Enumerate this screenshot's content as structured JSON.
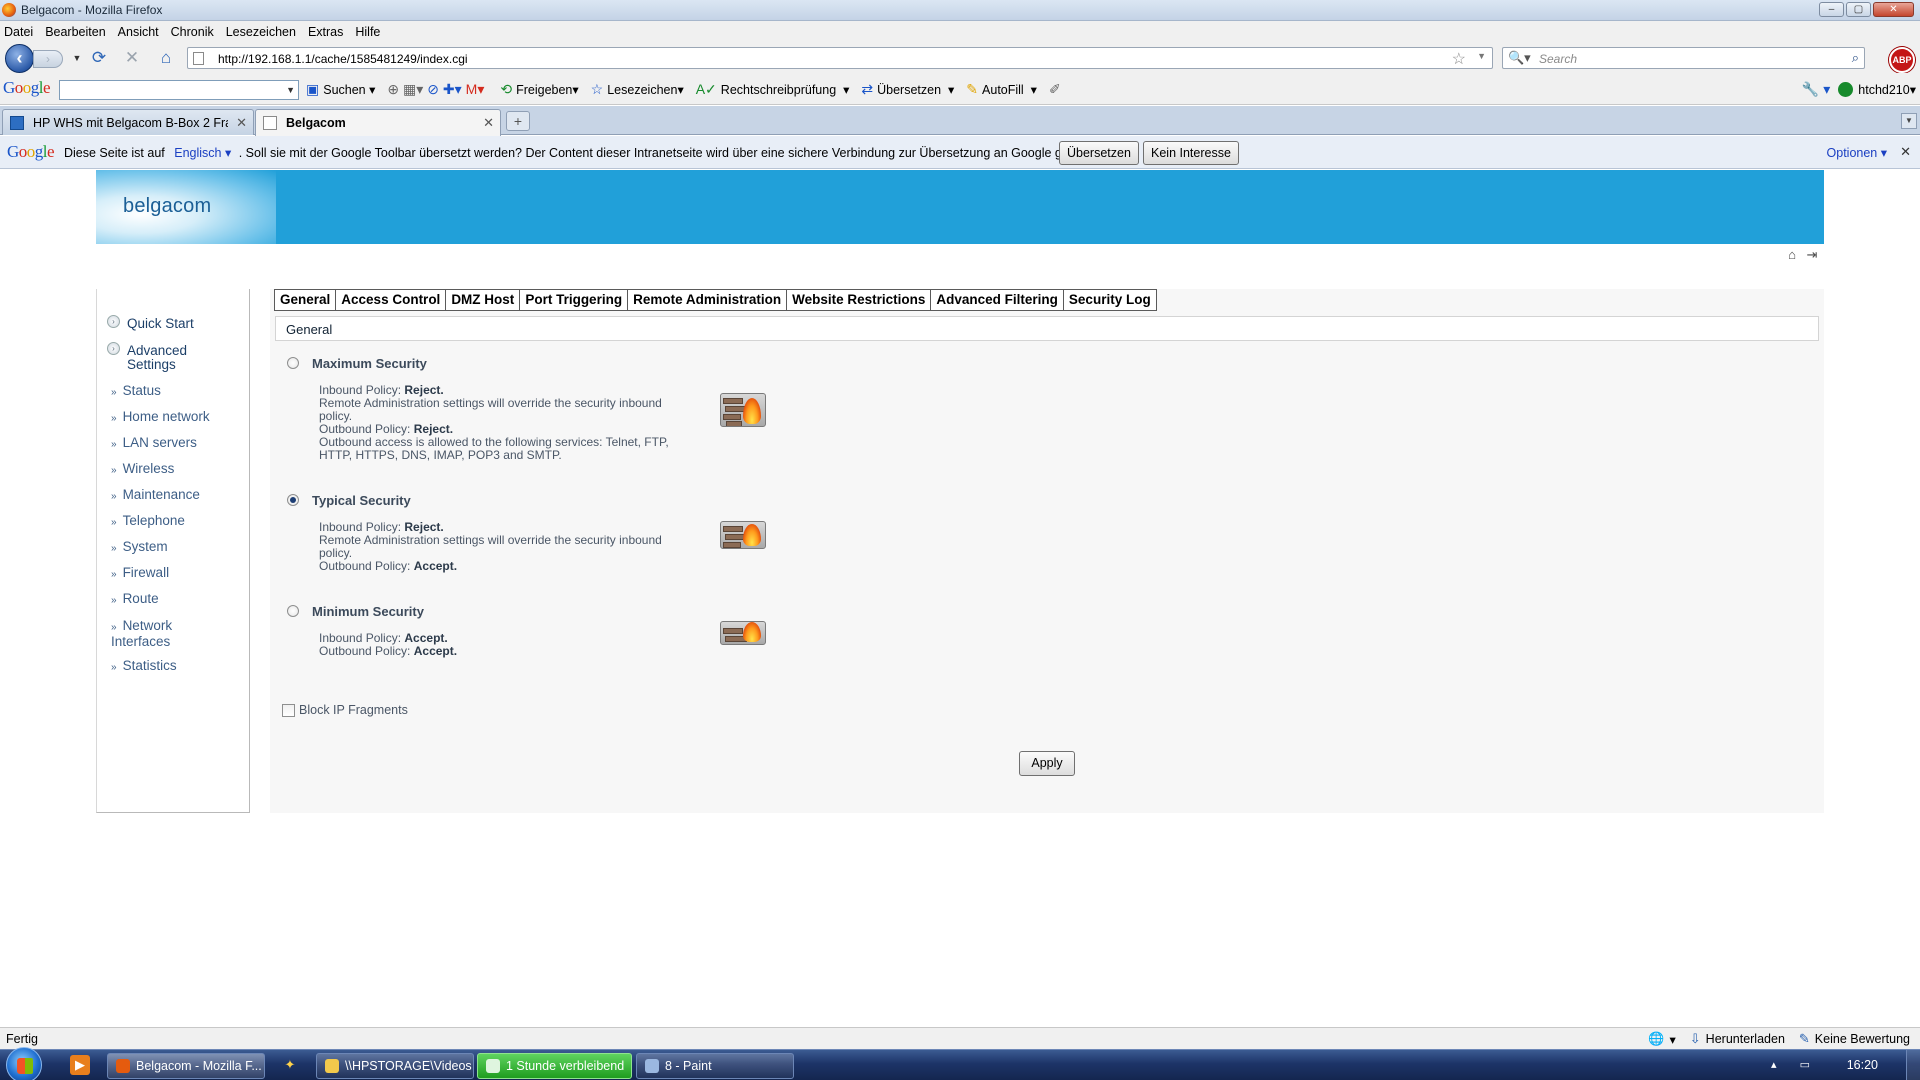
{
  "window": {
    "title": "Belgacom - Mozilla Firefox"
  },
  "menu": [
    "Datei",
    "Bearbeiten",
    "Ansicht",
    "Chronik",
    "Lesezeichen",
    "Extras",
    "Hilfe"
  ],
  "nav": {
    "url": "http://192.168.1.1/cache/1585481249/index.cgi",
    "search_placeholder": "Search",
    "abp_label": "ABP"
  },
  "google_toolbar": {
    "search_button": "Suchen",
    "items": [
      "Freigeben",
      "Lesezeichen",
      "Rechtschreibprüfung",
      "Übersetzen",
      "AutoFill"
    ],
    "user": "htchd210"
  },
  "tabs": [
    {
      "label": "HP WHS mit Belgacom B-Box 2 Fra...",
      "active": false
    },
    {
      "label": "Belgacom",
      "active": true
    }
  ],
  "translate_bar": {
    "prefix": "Diese Seite ist auf",
    "language": "Englisch",
    "message": ". Soll sie mit der Google Toolbar übersetzt werden? Der Content dieser Intranetseite wird über eine sichere Verbindung zur Übersetzung an Google gesendet.",
    "translate_button": "Übersetzen",
    "decline_button": "Kein Interesse",
    "options": "Optionen"
  },
  "router": {
    "logo": "belgacom",
    "sidebar": {
      "quick_start": "Quick Start",
      "advanced_settings": "Advanced Settings",
      "items": [
        "Status",
        "Home network",
        "LAN servers",
        "Wireless",
        "Maintenance",
        "Telephone",
        "System",
        "Firewall",
        "Route",
        "Network Interfaces",
        "Statistics"
      ]
    },
    "content_tabs": [
      "General",
      "Access Control",
      "DMZ Host",
      "Port Triggering",
      "Remote Administration",
      "Website Restrictions",
      "Advanced Filtering",
      "Security Log"
    ],
    "section_title": "General",
    "options": [
      {
        "title": "Maximum Security",
        "selected": false,
        "inbound_label": "Inbound Policy: ",
        "inbound_value": "Reject.",
        "remote_note": "Remote Administration settings will override the security inbound policy.",
        "outbound_label": "Outbound Policy: ",
        "outbound_value": "Reject.",
        "extra": "Outbound access is allowed to the following services: Telnet, FTP, HTTP, HTTPS, DNS, IMAP, POP3 and SMTP."
      },
      {
        "title": "Typical Security",
        "selected": true,
        "inbound_label": "Inbound Policy: ",
        "inbound_value": "Reject.",
        "remote_note": "Remote Administration settings will override the security inbound policy.",
        "outbound_label": "Outbound Policy: ",
        "outbound_value": "Accept."
      },
      {
        "title": "Minimum Security",
        "selected": false,
        "inbound_label": "Inbound Policy: ",
        "inbound_value": "Accept.",
        "outbound_label": "Outbound Policy: ",
        "outbound_value": "Accept."
      }
    ],
    "block_fragments_label": "Block IP Fragments",
    "block_fragments_checked": false,
    "apply_label": "Apply"
  },
  "statusbar": {
    "status": "Fertig",
    "download": "Herunterladen",
    "rating": "Keine Bewertung"
  },
  "taskbar": {
    "buttons": [
      "Belgacom - Mozilla F...",
      "\\\\HPSTORAGE\\Videos",
      "1 Stunde verbleibend",
      "8 - Paint"
    ],
    "clock": "16:20"
  }
}
